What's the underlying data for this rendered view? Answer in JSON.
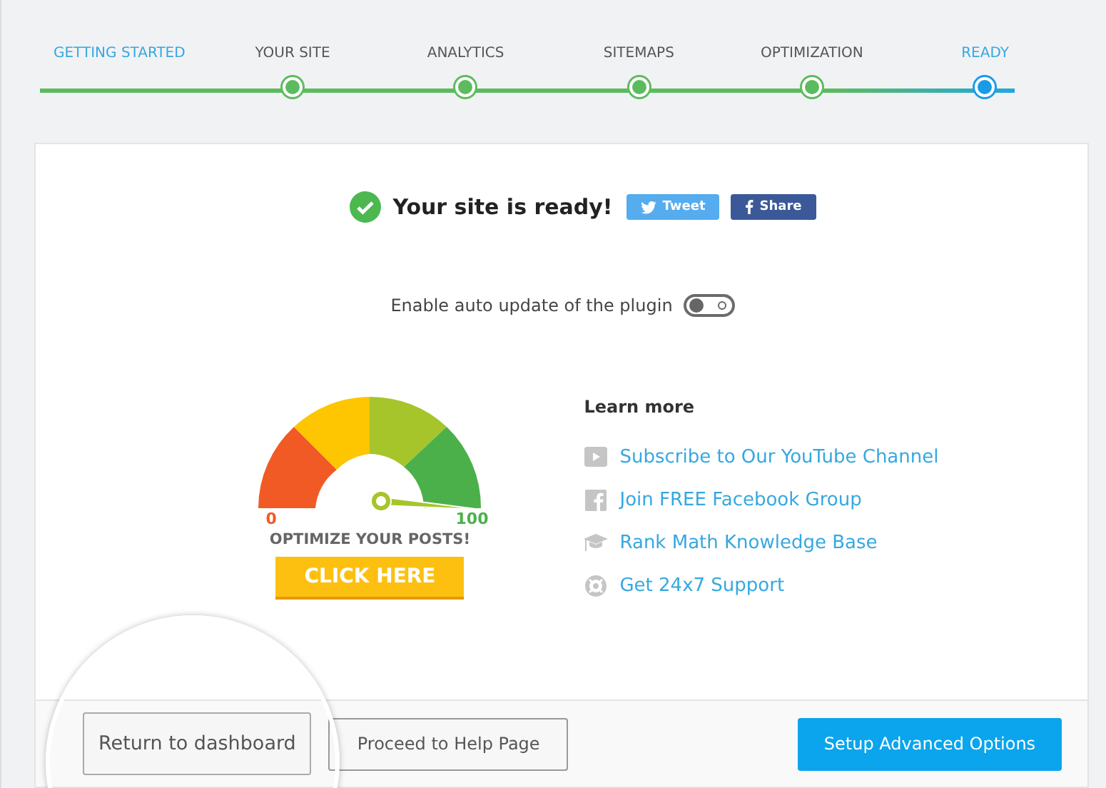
{
  "steps": [
    {
      "label": "GETTING STARTED",
      "kind": "start"
    },
    {
      "label": "YOUR SITE",
      "kind": "done"
    },
    {
      "label": "ANALYTICS",
      "kind": "done"
    },
    {
      "label": "SITEMAPS",
      "kind": "done"
    },
    {
      "label": "OPTIMIZATION",
      "kind": "done"
    },
    {
      "label": "READY",
      "kind": "current"
    }
  ],
  "heading": "Your site is ready!",
  "share_buttons": [
    {
      "label": "Tweet",
      "kind": "twitter"
    },
    {
      "label": "Share",
      "kind": "facebook"
    }
  ],
  "auto_update": {
    "label": "Enable auto update of the plugin",
    "on": false
  },
  "gauge": {
    "min_label": "0",
    "max_label": "100",
    "caption": "OPTIMIZE YOUR POSTS!",
    "button": "CLICK HERE"
  },
  "learn_more": {
    "title": "Learn more",
    "links": [
      {
        "label": "Subscribe to Our YouTube Channel",
        "kind": "video"
      },
      {
        "label": "Join FREE Facebook Group",
        "kind": "facebook"
      },
      {
        "label": "Rank Math Knowledge Base",
        "kind": "cap"
      },
      {
        "label": "Get 24x7 Support",
        "kind": "support"
      }
    ]
  },
  "footer": {
    "buttons": [
      {
        "label": "Return to dashboard",
        "kind": "magnified"
      },
      {
        "label": "Proceed to Help Page",
        "kind": "secondary"
      },
      {
        "label": "Setup Advanced Options",
        "kind": "primary"
      }
    ]
  }
}
